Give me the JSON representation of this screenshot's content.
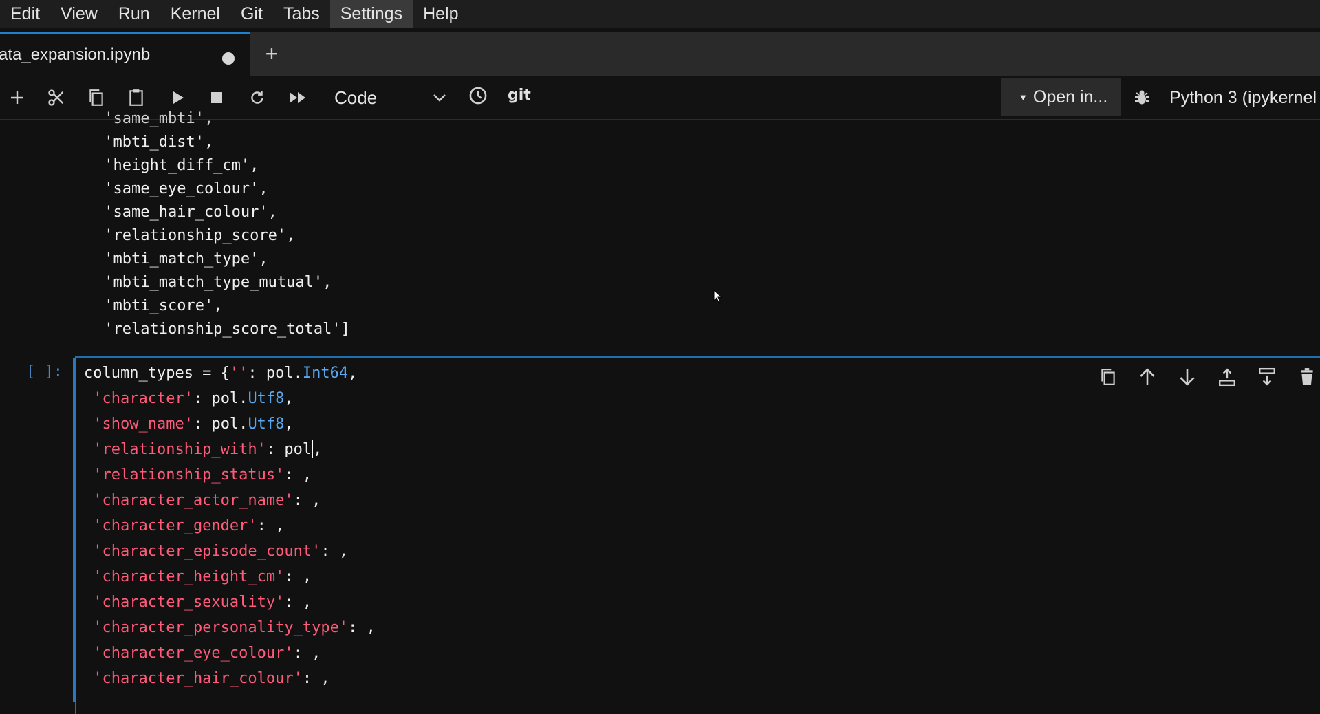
{
  "menu": [
    "Edit",
    "View",
    "Run",
    "Kernel",
    "Git",
    "Tabs",
    "Settings",
    "Help"
  ],
  "menu_active": "Settings",
  "tab": {
    "label": "ata_expansion.ipynb",
    "add_label": "+"
  },
  "toolbar": {
    "cell_type": "Code",
    "git_label": "git",
    "open_in_label": "Open in...",
    "kernel_name": "Python 3 (ipykernel"
  },
  "output_lines": [
    " 'same_mbti',",
    " 'mbti_dist',",
    " 'height_diff_cm',",
    " 'same_eye_colour',",
    " 'same_hair_colour',",
    " 'relationship_score',",
    " 'mbti_match_type',",
    " 'mbti_match_type_mutual',",
    " 'mbti_score',",
    " 'relationship_score_total']"
  ],
  "prompt": "[ ]:",
  "code": {
    "line0": {
      "a": "column_types = {",
      "b": "''",
      "c": ": pol.",
      "d": "Int64",
      "e": ","
    },
    "lines": [
      {
        "key": " 'character'",
        "mid": ": pol.",
        "type": "Utf8",
        "end": ","
      },
      {
        "key": " 'show_name'",
        "mid": ": pol.",
        "type": "Utf8",
        "end": ","
      },
      {
        "key": " 'relationship_with'",
        "mid": ": pol",
        "type": "",
        "end": ","
      },
      {
        "key": " 'relationship_status'",
        "mid": ": ,",
        "type": "",
        "end": ""
      },
      {
        "key": " 'character_actor_name'",
        "mid": ": ,",
        "type": "",
        "end": ""
      },
      {
        "key": " 'character_gender'",
        "mid": ": ,",
        "type": "",
        "end": ""
      },
      {
        "key": " 'character_episode_count'",
        "mid": ": ,",
        "type": "",
        "end": ""
      },
      {
        "key": " 'character_height_cm'",
        "mid": ": ,",
        "type": "",
        "end": ""
      },
      {
        "key": " 'character_sexuality'",
        "mid": ": ,",
        "type": "",
        "end": ""
      },
      {
        "key": " 'character_personality_type'",
        "mid": ": ,",
        "type": "",
        "end": ""
      },
      {
        "key": " 'character_eye_colour'",
        "mid": ": ,",
        "type": "",
        "end": ""
      },
      {
        "key": " 'character_hair_colour'",
        "mid": ": ,",
        "type": "",
        "end": ""
      }
    ]
  },
  "colors": {
    "accent": "#1f7fd0",
    "string": "#ff5a7a",
    "type": "#5aa9f0",
    "background": "#111111"
  }
}
